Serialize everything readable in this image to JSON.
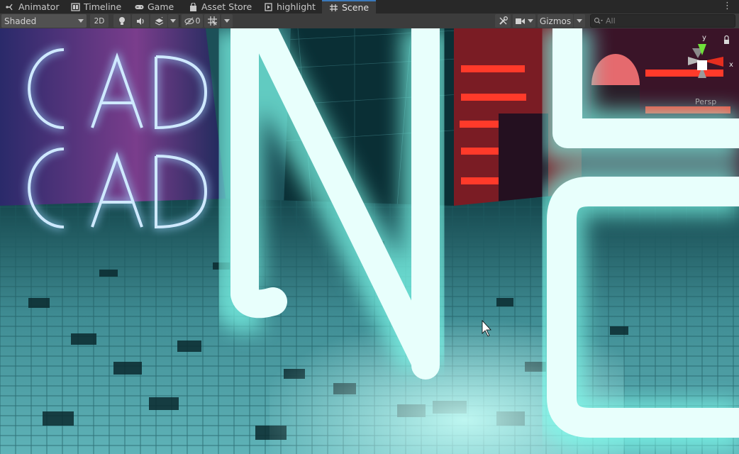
{
  "tabs": [
    {
      "label": "Animator",
      "icon": "animator-icon"
    },
    {
      "label": "Timeline",
      "icon": "timeline-icon"
    },
    {
      "label": "Game",
      "icon": "gamepad-icon"
    },
    {
      "label": "Asset Store",
      "icon": "shopping-bag-icon"
    },
    {
      "label": "highlight",
      "icon": "clip-icon"
    },
    {
      "label": "Scene",
      "icon": "grid-icon",
      "active": true
    }
  ],
  "toolbar": {
    "shading_mode": "Shaded",
    "mode_2d": "2D",
    "hidden_count": "0",
    "gizmos_label": "Gizmos",
    "search_placeholder": "All"
  },
  "gizmo": {
    "projection": "Persp",
    "axis_y": "y",
    "axis_x": "x"
  },
  "colors": {
    "active_tab_accent": "#3a79bb",
    "neon_cyan": "#a8fff6",
    "neon_red": "#ff3a2a",
    "axis_y": "#6fe03a",
    "axis_x": "#e52e1f"
  }
}
